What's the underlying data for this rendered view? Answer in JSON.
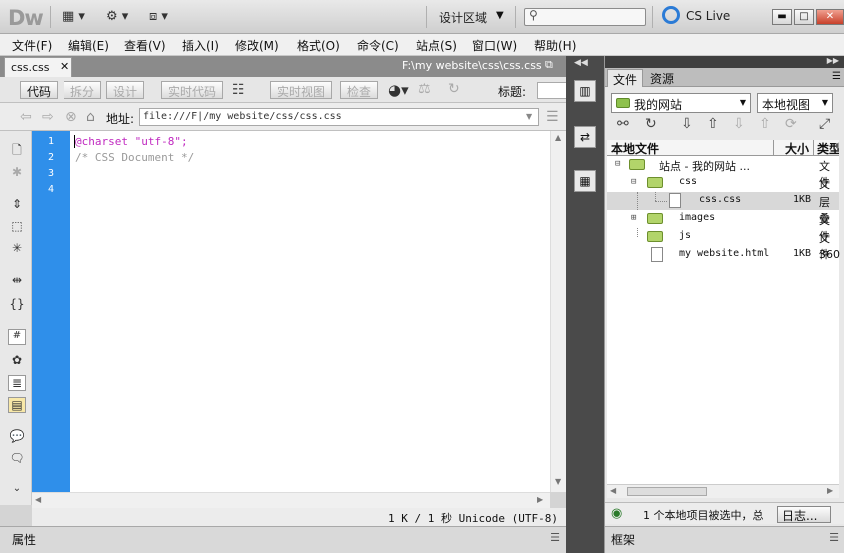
{
  "app": {
    "logo": "Dw",
    "workspace": "设计区域",
    "cslive": "CS Live"
  },
  "menu": [
    "文件(F)",
    "编辑(E)",
    "查看(V)",
    "插入(I)",
    "修改(M)",
    "格式(O)",
    "命令(C)",
    "站点(S)",
    "窗口(W)",
    "帮助(H)"
  ],
  "document": {
    "tab": "css.css",
    "path": "F:\\my website\\css\\css.css",
    "views": {
      "code": "代码",
      "split": "拆分",
      "design": "设计",
      "live_code": "实时代码",
      "live_view": "实时视图",
      "inspect": "检查"
    },
    "title_label": "标题:",
    "address_label": "地址:",
    "address": "file:///F|/my website/css/css.css",
    "line_numbers": [
      "1",
      "2",
      "3",
      "4"
    ],
    "code_lines": [
      "@charset \"utf-8\";",
      "/* CSS Document */"
    ],
    "status": "1 K / 1 秒 Unicode (UTF-8)"
  },
  "properties_label": "属性",
  "files_panel": {
    "tabs": [
      "文件",
      "资源"
    ],
    "site": "我的网站",
    "view": "本地视图",
    "headers": {
      "name": "本地文件",
      "size": "大小",
      "type": "类型"
    },
    "rows": [
      {
        "tree": "⊟",
        "name": "站点 - 我的网站 ...",
        "size": "",
        "type": "文件"
      },
      {
        "tree": "⊟",
        "name": "css",
        "size": "",
        "type": "文件"
      },
      {
        "tree": "",
        "name": "css.css",
        "size": "1KB",
        "type": "层叠"
      },
      {
        "tree": "⊞",
        "name": "images",
        "size": "",
        "type": "文件"
      },
      {
        "tree": "",
        "name": "js",
        "size": "",
        "type": "文件"
      },
      {
        "tree": "",
        "name": "my website.html",
        "size": "1KB",
        "type": "360"
      }
    ],
    "status": "1 个本地项目被选中，总",
    "log_button": "日志..."
  },
  "frames_label": "框架"
}
